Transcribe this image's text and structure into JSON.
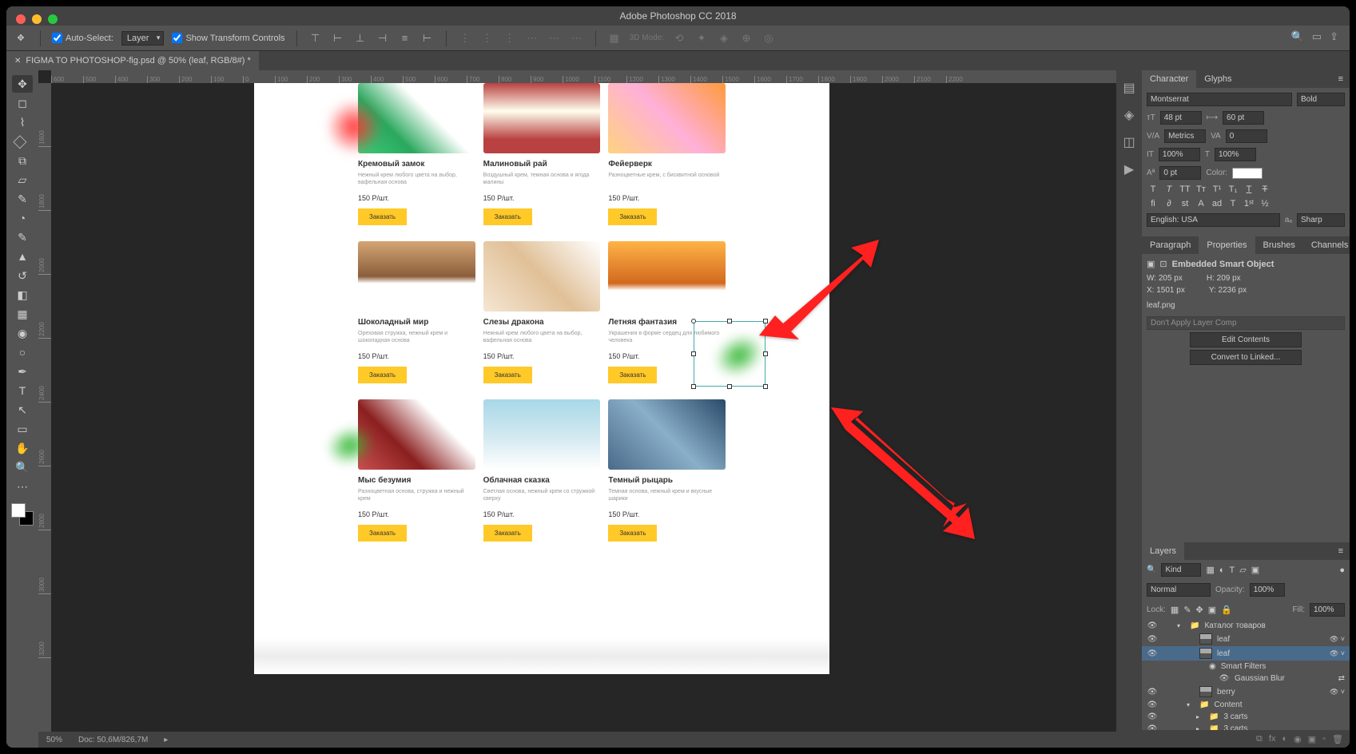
{
  "app_title": "Adobe Photoshop CC 2018",
  "doc_tab": "FIGMA TO PHOTOSHOP-fig.psd @ 50% (leaf, RGB/8#) *",
  "options": {
    "auto_select": "Auto-Select:",
    "layer_dd": "Layer",
    "show_transform": "Show Transform Controls",
    "mode_3d": "3D Mode:"
  },
  "ruler_h": [
    "600",
    "500",
    "400",
    "300",
    "200",
    "100",
    "0",
    "100",
    "200",
    "300",
    "400",
    "500",
    "600",
    "700",
    "800",
    "900",
    "1000",
    "1100",
    "1200",
    "1300",
    "1400",
    "1500",
    "1600",
    "1700",
    "1800",
    "1900",
    "2000",
    "2100",
    "2200"
  ],
  "ruler_v": [
    "1600",
    "1800",
    "2000",
    "2200",
    "2400",
    "2600",
    "2800",
    "3000",
    "3200"
  ],
  "status": {
    "zoom": "50%",
    "doc_size": "Doc: 50,6M/826,7M"
  },
  "products": [
    {
      "title": "Кремовый замок",
      "desc": "Нежный крем любого цвета на выбор, вафельная основа",
      "price": "150 Р/шт.",
      "btn": "Заказать",
      "thumb_class": "t1"
    },
    {
      "title": "Малиновый рай",
      "desc": "Воздушный крем, темная основа и ягода малины",
      "price": "150 Р/шт.",
      "btn": "Заказать",
      "thumb_class": "t2"
    },
    {
      "title": "Фейерверк",
      "desc": "Разноцветные крем, с бисквитной основой",
      "price": "150 Р/шт.",
      "btn": "Заказать",
      "thumb_class": "t3"
    },
    {
      "title": "Шоколадный мир",
      "desc": "Ореховая стружка, нежный крем и шоколадная основа",
      "price": "150 Р/шт.",
      "btn": "Заказать",
      "thumb_class": "t4"
    },
    {
      "title": "Слезы дракона",
      "desc": "Нежный крем любого цвета на выбор, вафельная основа",
      "price": "150 Р/шт.",
      "btn": "Заказать",
      "thumb_class": "t5"
    },
    {
      "title": "Летняя фантазия",
      "desc": "Украшения в форме сердец для любимого человека",
      "price": "150 Р/шт.",
      "btn": "Заказать",
      "thumb_class": "t6"
    },
    {
      "title": "Мыс безумия",
      "desc": "Разноцветная основа, стружка и нежный крем",
      "price": "150 Р/шт.",
      "btn": "Заказать",
      "thumb_class": "t7"
    },
    {
      "title": "Облачная сказка",
      "desc": "Светлая основа, нежный крем со стружкой сверху",
      "price": "150 Р/шт.",
      "btn": "Заказать",
      "thumb_class": "t8"
    },
    {
      "title": "Темный рыцарь",
      "desc": "Темная основа, нежный крем и вкусные шарики",
      "price": "150 Р/шт.",
      "btn": "Заказать",
      "thumb_class": "t9"
    }
  ],
  "character": {
    "tab1": "Character",
    "tab2": "Glyphs",
    "font": "Montserrat",
    "weight": "Bold",
    "size": "48 pt",
    "leading": "60 pt",
    "kerning": "Metrics",
    "tracking": "0",
    "vscale": "100%",
    "hscale": "100%",
    "baseline": "0 pt",
    "color_label": "Color:",
    "lang": "English: USA",
    "aa": "Sharp"
  },
  "panels2": {
    "t1": "Paragraph",
    "t2": "Properties",
    "t3": "Brushes",
    "t4": "Channels"
  },
  "props": {
    "type": "Embedded Smart Object",
    "w_label": "W:",
    "w": "205 px",
    "h_label": "H:",
    "h": "209 px",
    "x_label": "X:",
    "x": "1501 px",
    "y_label": "Y:",
    "y": "2236 px",
    "file": "leaf.png",
    "layer_comp": "Don't Apply Layer Comp",
    "edit_btn": "Edit Contents",
    "convert_btn": "Convert to Linked..."
  },
  "layers": {
    "tab": "Layers",
    "kind": "Kind",
    "blend": "Normal",
    "opacity_lbl": "Opacity:",
    "opacity": "100%",
    "lock_lbl": "Lock:",
    "fill_lbl": "Fill:",
    "fill": "100%",
    "items": [
      {
        "name": "Каталог товаров",
        "indent": 1,
        "group": true,
        "open": true
      },
      {
        "name": "leaf",
        "indent": 2,
        "so": true,
        "fx": true
      },
      {
        "name": "leaf",
        "indent": 2,
        "so": true,
        "fx": true,
        "sel": true,
        "open": true
      },
      {
        "name": "Smart Filters",
        "indent": 3,
        "filter": true
      },
      {
        "name": "Gaussian Blur",
        "indent": 4,
        "sub": true,
        "edit": true
      },
      {
        "name": "berry",
        "indent": 2,
        "so": true,
        "fx": true
      },
      {
        "name": "Content",
        "indent": 2,
        "group": true,
        "open": true
      },
      {
        "name": "3 carts",
        "indent": 3,
        "group": true
      },
      {
        "name": "3 carts",
        "indent": 3,
        "group": true
      }
    ]
  }
}
